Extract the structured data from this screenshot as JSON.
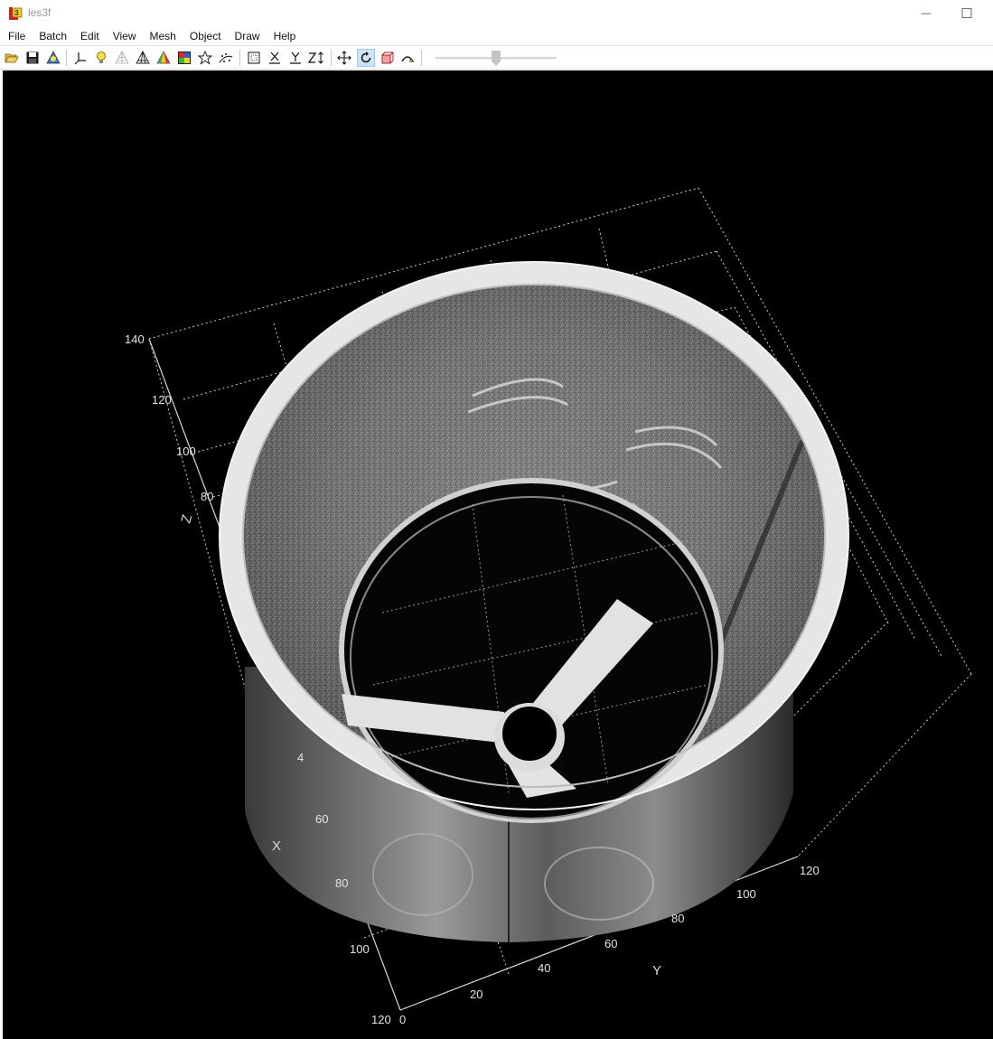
{
  "window": {
    "title": "les3f",
    "minimize_glyph": "—",
    "maximize_glyph": "☐"
  },
  "menu": [
    "File",
    "Batch",
    "Edit",
    "View",
    "Mesh",
    "Object",
    "Draw",
    "Help"
  ],
  "toolbar": {
    "buttons": [
      "open-icon",
      "save-icon",
      "volume-icon",
      "axes-icon",
      "light-icon",
      "wireframe-icon",
      "mesh-icon",
      "color-cone-icon",
      "colormap-icon",
      "star-icon",
      "points-icon",
      "bounding-box-icon",
      "axis-x-icon",
      "axis-y-icon",
      "axis-z-icon",
      "pan-icon",
      "rotate-icon",
      "clip-icon",
      "arc-icon"
    ],
    "active": "rotate-icon",
    "axis_labels": {
      "x": "X",
      "y": "Y",
      "z": "Z"
    }
  },
  "plot": {
    "z_ticks": [
      "140",
      "120",
      "100",
      "80"
    ],
    "x_ticks": [
      "4",
      "60",
      "80",
      "100",
      "120"
    ],
    "y_ticks": [
      "0",
      "20",
      "40",
      "60",
      "80",
      "100",
      "120"
    ],
    "x_label": "X",
    "y_label": "Y",
    "z_label": "Z"
  }
}
